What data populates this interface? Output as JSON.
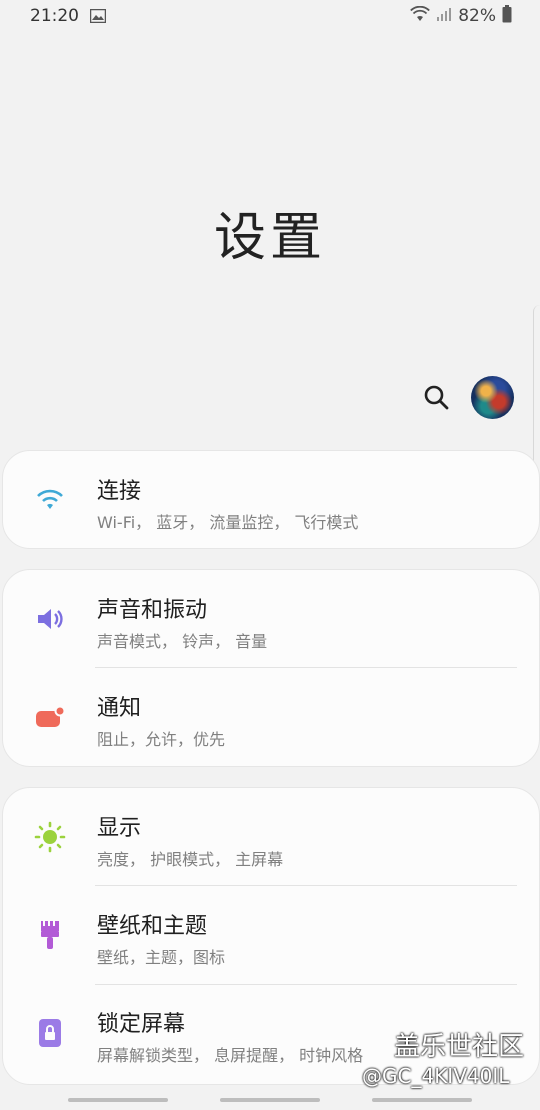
{
  "status": {
    "time": "21:20",
    "battery": "82%"
  },
  "page": {
    "title": "设置"
  },
  "sections": [
    {
      "items": [
        {
          "title": "连接",
          "sub": "Wi-Fi， 蓝牙， 流量监控， 飞行模式",
          "icon": "wifi-icon"
        }
      ]
    },
    {
      "items": [
        {
          "title": "声音和振动",
          "sub": "声音模式， 铃声， 音量",
          "icon": "speaker-icon"
        },
        {
          "title": "通知",
          "sub": "阻止，允许，优先",
          "icon": "notification-icon"
        }
      ]
    },
    {
      "items": [
        {
          "title": "显示",
          "sub": "亮度， 护眼模式， 主屏幕",
          "icon": "brightness-icon"
        },
        {
          "title": "壁纸和主题",
          "sub": "壁纸，主题，图标",
          "icon": "brush-icon"
        },
        {
          "title": "锁定屏幕",
          "sub": "屏幕解锁类型， 息屏提醒， 时钟风格",
          "icon": "lock-icon"
        }
      ]
    }
  ],
  "watermark": {
    "line1": "盖乐世社区",
    "line2": "@GC_4KIV40IL"
  },
  "colors": {
    "wifi": "#3fa9d6",
    "sound": "#7c6fe0",
    "notif": "#ef6a5a",
    "display": "#9bd23d",
    "theme": "#b25ad6",
    "lock": "#9b7be6"
  }
}
